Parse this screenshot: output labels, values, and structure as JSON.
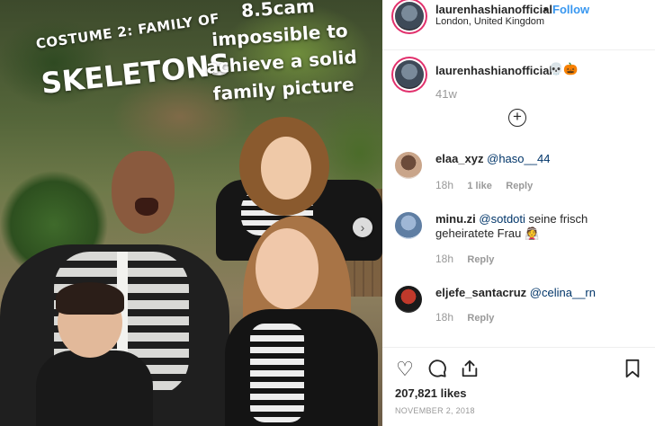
{
  "photo": {
    "overlay_lines": {
      "costume": "COSTUME 2: FAMILY OF",
      "skeletons": "SKELETONS",
      "caption": "8.5cam impossible to achieve a solid family picture"
    },
    "next_arrow": "›"
  },
  "header": {
    "username": "laurenhashianofficial",
    "separator": "•",
    "follow_label": "Follow",
    "location": "London, United Kingdom"
  },
  "caption": {
    "username": "laurenhashianofficial",
    "emoji": "💀🎃",
    "time": "41w",
    "load_more_icon": "+"
  },
  "comments": [
    {
      "username": "elaa_xyz",
      "mention": "@haso__44",
      "text": "",
      "time": "18h",
      "likes": "1 like",
      "reply": "Reply"
    },
    {
      "username": "minu.zi",
      "mention": "@sotdoti",
      "text": " seine frisch geheiratete Frau 👰",
      "time": "18h",
      "likes": "",
      "reply": "Reply"
    },
    {
      "username": "eljefe_santacruz",
      "mention": "@celina__rn",
      "text": "",
      "time": "18h",
      "likes": "",
      "reply": "Reply"
    }
  ],
  "actions": {
    "like_icon": "♡",
    "comment_icon": "◯",
    "share_icon": "⇪",
    "bookmark_icon": "⚑",
    "likes_count": "207,821 likes",
    "date": "NOVEMBER 2, 2018"
  },
  "colors": {
    "follow_blue": "#3897f0",
    "mention_blue": "#003569",
    "secondary_gray": "#999999"
  }
}
